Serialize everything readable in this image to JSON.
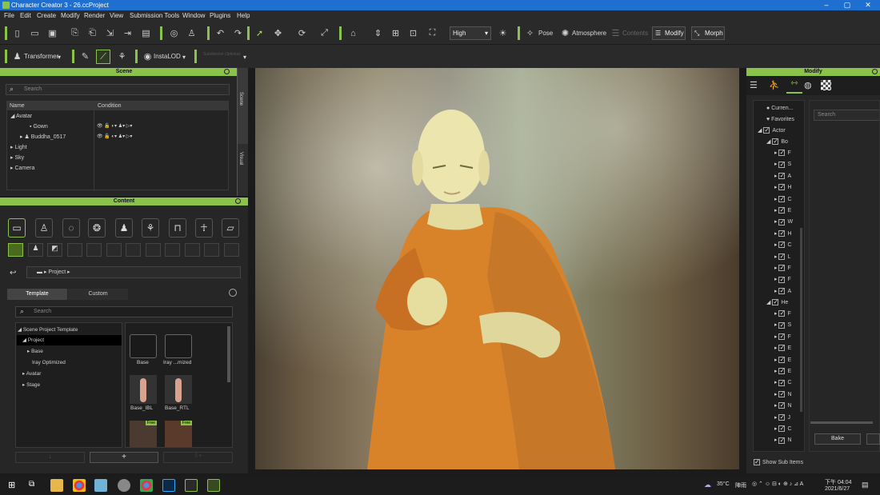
{
  "window": {
    "title": "Character Creator 3 - 26.ccProject",
    "minimize": "–",
    "maximize": "▢",
    "close": "✕"
  },
  "menu": [
    "File",
    "Edit",
    "Create",
    "Modify",
    "Render",
    "View",
    "Submission Tools",
    "Window",
    "Plugins",
    "Help"
  ],
  "toolbar": {
    "quality": "High",
    "pose": "Pose",
    "atmosphere": "Atmosphere",
    "contents": "Contents",
    "modify": "Modify",
    "morph": "Morph",
    "transformer": "Transformer",
    "instalod": "InstaLOD",
    "subdivision": "Subdivision Optimize"
  },
  "scene": {
    "title": "Scene",
    "search_placeholder": "Search",
    "col_name": "Name",
    "col_condition": "Condition",
    "rows": [
      "Avatar",
      "Gown",
      "Buddha_0517",
      "Light",
      "Sky",
      "Camera"
    ],
    "side_tabs": [
      "Scene",
      "Visual"
    ]
  },
  "content": {
    "title": "Content",
    "breadcrumb": "Project",
    "tabs": [
      "Template",
      "Custom"
    ],
    "search_placeholder": "Search",
    "tree": [
      "Scene Project Template",
      "Project",
      "Base",
      "Iray Optimized",
      "Avatar",
      "Stage"
    ],
    "thumbs": [
      "Base",
      "Iray ...mized",
      "Base_IBL",
      "Base_RTL"
    ],
    "free_badge": "Free",
    "add": "+"
  },
  "modify": {
    "title": "Modify",
    "search_placeholder": "Search",
    "tree_top": [
      "Curren...",
      "Favorites",
      "Actor",
      "Bo"
    ],
    "body_items": [
      "F",
      "S",
      "A",
      "H",
      "C",
      "E",
      "W",
      "H",
      "C",
      "L",
      "F",
      "F",
      "A"
    ],
    "head": "He",
    "head_items": [
      "F",
      "S",
      "F",
      "E",
      "E",
      "E",
      "C",
      "N",
      "N",
      "J",
      "C",
      "N"
    ],
    "bake": "Bake",
    "show_sub": "Show Sub Items"
  },
  "taskbar": {
    "weather": "35°C",
    "weather_desc": "陣雨",
    "time": "下午 04:04",
    "date": "2021/6/27"
  },
  "colors": {
    "accent": "#8bc34a",
    "titlebar": "#1f6fd0",
    "robe": "#d8822a",
    "skin": "#e9e2a8"
  }
}
